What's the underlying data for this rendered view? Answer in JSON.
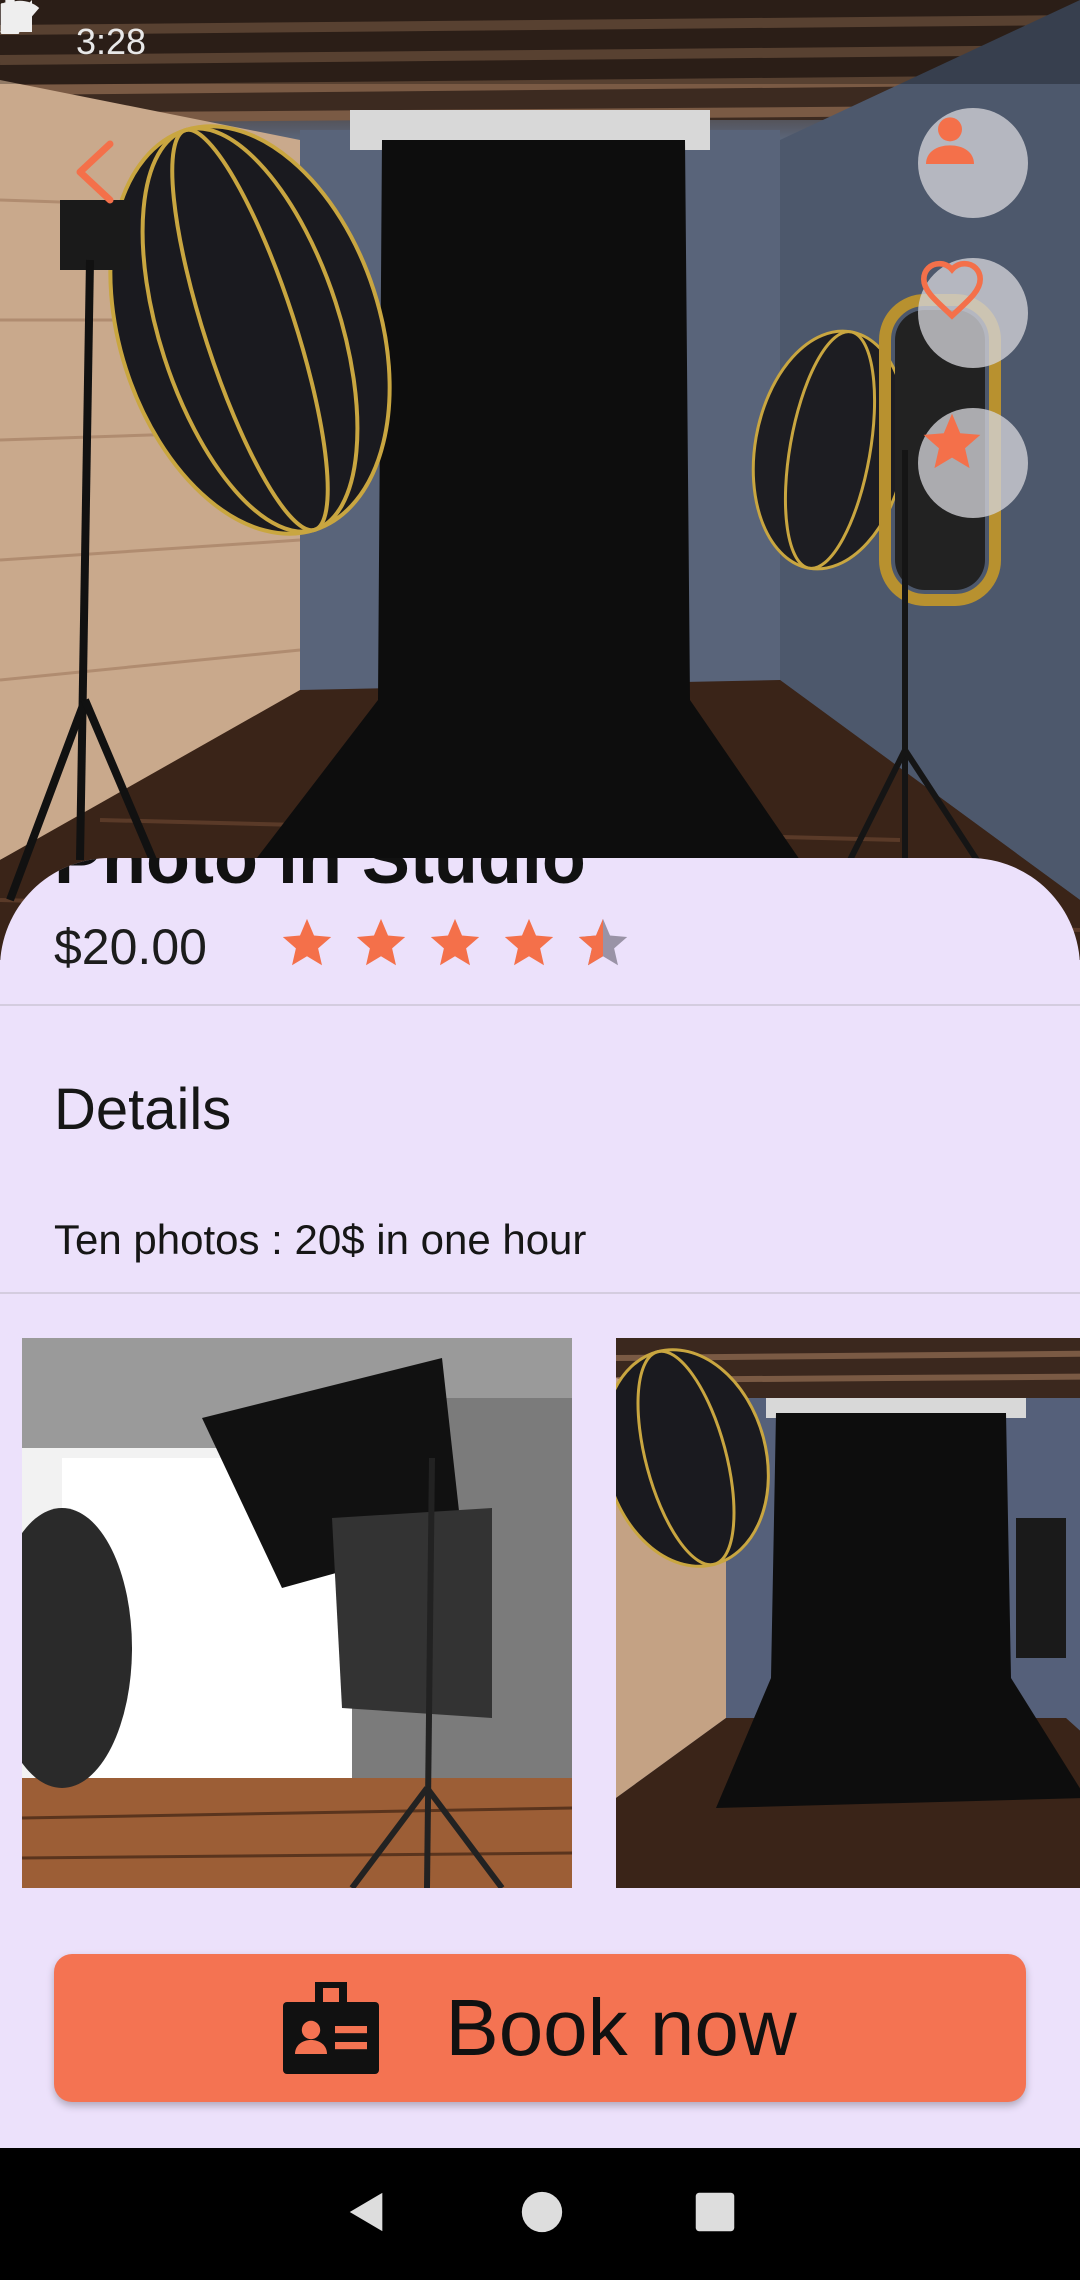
{
  "status_bar": {
    "time": "3:28",
    "left_icons": [
      "settings-icon",
      "keyboard-a-icon",
      "gmail-icon"
    ],
    "right_icons": [
      "wifi-icon",
      "signal-icon",
      "battery-icon"
    ]
  },
  "header": {
    "back_icon": "chevron-left-icon",
    "actions": [
      "profile-icon",
      "heart-outline-icon",
      "star-icon"
    ]
  },
  "listing": {
    "title_partial": "Photo in Studio",
    "price": "$20.00",
    "rating": 4.5,
    "rating_max": 5,
    "details_heading": "Details",
    "details_text": "Ten photos : 20$ in one hour"
  },
  "gallery": {
    "images": [
      "studio-softbox-white-photo",
      "studio-black-backdrop-photo"
    ]
  },
  "cta": {
    "label": "Book now",
    "icon": "id-badge-icon"
  },
  "nav_bar": {
    "buttons": [
      "back-triangle-icon",
      "home-circle-icon",
      "recents-square-icon"
    ]
  },
  "colors": {
    "accent": "#f47352",
    "star": "#f4704a",
    "sheet_bg": "#ece1fb",
    "star_empty": "#9a93a6"
  }
}
